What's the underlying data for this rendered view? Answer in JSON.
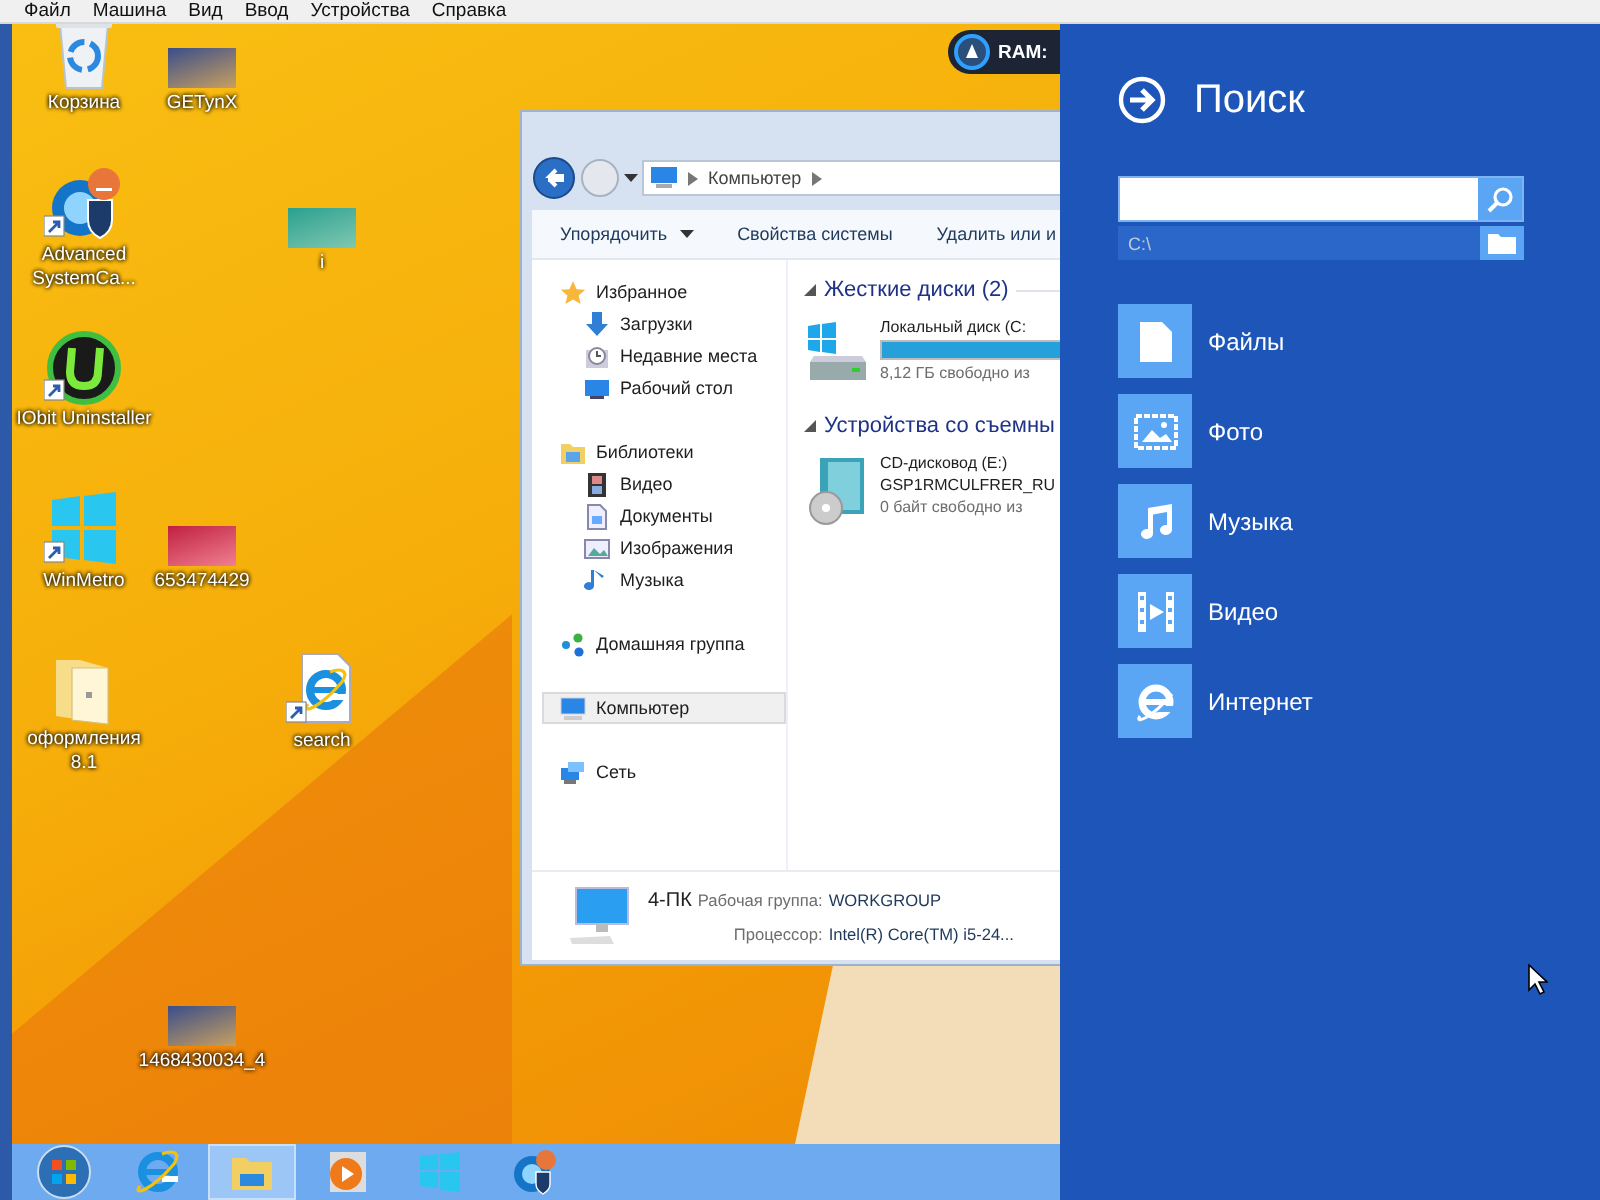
{
  "menu_bar": [
    "Файл",
    "Машина",
    "Вид",
    "Ввод",
    "Устройства",
    "Справка"
  ],
  "desktop_icons": [
    {
      "label": "Корзина",
      "kind": "recycle",
      "shortcut": false
    },
    {
      "label": "GETynX",
      "kind": "photo",
      "shortcut": false
    },
    {
      "label": "Advanced SystemCa...",
      "kind": "care",
      "shortcut": true
    },
    {
      "label": "i",
      "kind": "photo",
      "shortcut": false
    },
    {
      "label": "IObit Uninstaller",
      "kind": "uninstaller",
      "shortcut": true
    },
    {
      "label": "WinMetro",
      "kind": "winmetro",
      "shortcut": true
    },
    {
      "label": "653474429",
      "kind": "photo",
      "shortcut": false
    },
    {
      "label": "оформления 8.1",
      "kind": "folder",
      "shortcut": false
    },
    {
      "label": "search",
      "kind": "ie",
      "shortcut": true
    },
    {
      "label": "1468430034_4",
      "kind": "photo",
      "shortcut": false
    }
  ],
  "ram_widget": {
    "label": "RAM:"
  },
  "explorer": {
    "breadcrumb": "Компьютер",
    "toolbar": [
      {
        "label": "Упорядочить",
        "kind": "menu"
      },
      {
        "label": "Свойства системы",
        "kind": "button"
      },
      {
        "label": "Удалить или и",
        "kind": "button"
      }
    ],
    "nav": [
      {
        "label": "Избранное",
        "kind": "star",
        "selected": false,
        "children": [
          {
            "label": "Загрузки",
            "kind": "download",
            "selected": false
          },
          {
            "label": "Недавние места",
            "kind": "recent",
            "selected": false
          },
          {
            "label": "Рабочий стол",
            "kind": "desktop",
            "selected": false
          }
        ]
      },
      {
        "label": "Библиотеки",
        "kind": "library",
        "selected": false,
        "children": [
          {
            "label": "Видео",
            "kind": "video",
            "selected": false
          },
          {
            "label": "Документы",
            "kind": "docs",
            "selected": false
          },
          {
            "label": "Изображения",
            "kind": "images",
            "selected": false
          },
          {
            "label": "Музыка",
            "kind": "music",
            "selected": false
          }
        ]
      },
      {
        "label": "Домашняя группа",
        "kind": "homegroup",
        "selected": false
      },
      {
        "label": "Компьютер",
        "kind": "computer",
        "selected": true
      },
      {
        "label": "Сеть",
        "kind": "network",
        "selected": false
      }
    ],
    "sections": [
      {
        "title": "Жесткие диски (2)",
        "drives": [
          {
            "kind": "disk",
            "name": "Локальный диск (C:",
            "level": 0.85,
            "info": "8,12 ГБ свободно из"
          }
        ]
      },
      {
        "title": "Устройства со съемны",
        "drives": [
          {
            "kind": "cd",
            "name": "CD-дисковод (E:)",
            "volume": "GSP1RMCULFRER_RU",
            "info": "0 байт свободно из"
          }
        ]
      }
    ],
    "details": {
      "name": "4-ПК",
      "fields": [
        {
          "label": "Рабочая группа:",
          "value": "WORKGROUP"
        },
        {
          "label": "Процессор:",
          "value": "Intel(R) Core(TM) i5-24..."
        }
      ]
    }
  },
  "taskbar": {
    "items": [
      {
        "kind": "start",
        "selected": false
      },
      {
        "kind": "ie",
        "selected": false
      },
      {
        "kind": "explorer",
        "selected": true
      },
      {
        "kind": "media",
        "selected": false
      },
      {
        "kind": "winmetro",
        "selected": false
      },
      {
        "kind": "care",
        "selected": false
      }
    ]
  },
  "search_panel": {
    "title": "Поиск",
    "path": "C:\\",
    "categories": [
      {
        "label": "Файлы",
        "kind": "files"
      },
      {
        "label": "Фото",
        "kind": "photo"
      },
      {
        "label": "Музыка",
        "kind": "music"
      },
      {
        "label": "Видео",
        "kind": "video"
      },
      {
        "label": "Интернет",
        "kind": "internet"
      }
    ]
  }
}
